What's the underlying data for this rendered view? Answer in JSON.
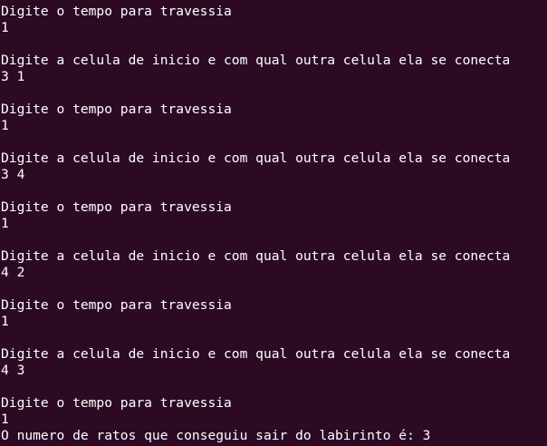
{
  "terminal": {
    "lines": [
      "Digite o tempo para travessia",
      "1",
      "",
      "Digite a celula de inicio e com qual outra celula ela se conecta",
      "3 1",
      "",
      "Digite o tempo para travessia",
      "1",
      "",
      "Digite a celula de inicio e com qual outra celula ela se conecta",
      "3 4",
      "",
      "Digite o tempo para travessia",
      "1",
      "",
      "Digite a celula de inicio e com qual outra celula ela se conecta",
      "4 2",
      "",
      "Digite o tempo para travessia",
      "1",
      "",
      "Digite a celula de inicio e com qual outra celula ela se conecta",
      "4 3",
      "",
      "Digite o tempo para travessia",
      "1",
      "O numero de ratos que conseguiu sair do labirinto é: 3"
    ]
  }
}
